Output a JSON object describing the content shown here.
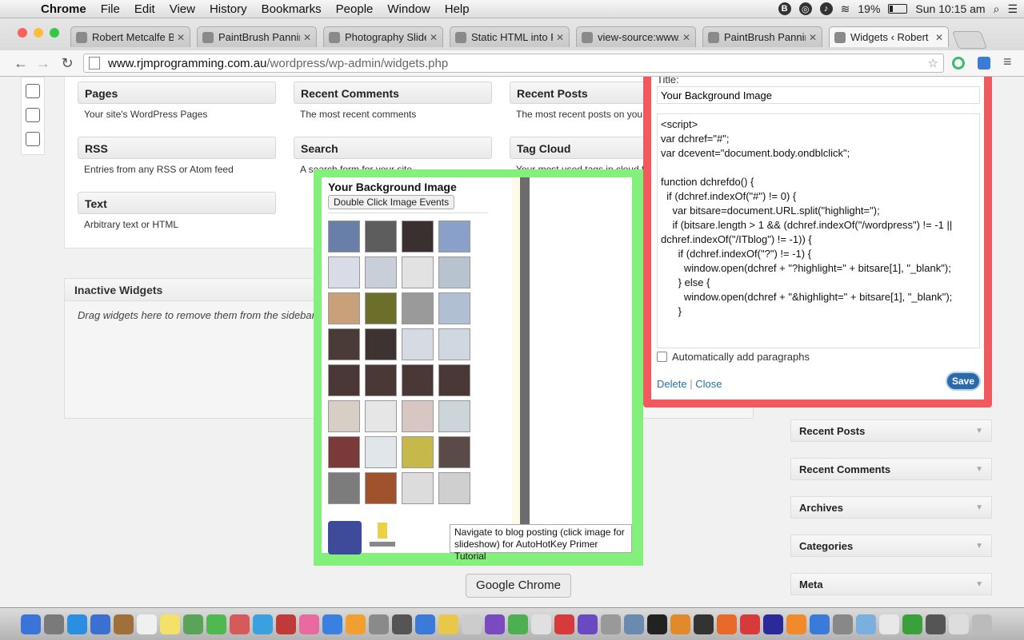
{
  "menubar": {
    "app": "Chrome",
    "items": [
      "File",
      "Edit",
      "View",
      "History",
      "Bookmarks",
      "People",
      "Window",
      "Help"
    ],
    "battery": "19%",
    "clock": "Sun 10:15 am"
  },
  "tabs": [
    {
      "label": "Robert Metcalfe Blo"
    },
    {
      "label": "PaintBrush Panning"
    },
    {
      "label": "Photography Slidesh"
    },
    {
      "label": "Static HTML into PH"
    },
    {
      "label": "view-source:www.rjm"
    },
    {
      "label": "PaintBrush Panning"
    },
    {
      "label": "Widgets ‹ Robert Me"
    }
  ],
  "url": {
    "host": "www.rjmprogramming.com.au",
    "path": "/wordpress/wp-admin/widgets.php"
  },
  "available_widgets": [
    {
      "title": "Pages",
      "desc": "Your site's WordPress Pages"
    },
    {
      "title": "Recent Comments",
      "desc": "The most recent comments"
    },
    {
      "title": "Recent Posts",
      "desc": "The most recent posts on your"
    },
    {
      "title": "RSS",
      "desc": "Entries from any RSS or Atom feed"
    },
    {
      "title": "Search",
      "desc": "A search form for your site"
    },
    {
      "title": "Tag Cloud",
      "desc": "Your most used tags in cloud f"
    },
    {
      "title": "Text",
      "desc": "Arbitrary text or HTML"
    }
  ],
  "inactive": {
    "title": "Inactive Widgets",
    "desc": "Drag widgets here to remove them from the sidebar"
  },
  "sidebar_widgets": [
    "Recent Posts",
    "Recent Comments",
    "Archives",
    "Categories",
    "Meta"
  ],
  "editor": {
    "title_label": "Title:",
    "title_value": "Your Background Image",
    "code": "<script>\nvar dchref=\"#\";\nvar dcevent=\"document.body.ondblclick\";\n\nfunction dchrefdo() {\n  if (dchref.indexOf(\"#\") != 0) {\n    var bitsare=document.URL.split(\"highlight=\");\n    if (bitsare.length > 1 && (dchref.indexOf(\"/wordpress\") != -1 || dchref.indexOf(\"/ITblog\") != -1)) {\n      if (dchref.indexOf(\"?\") != -1) {\n        window.open(dchref + \"?highlight=\" + bitsare[1], \"_blank\");\n      } else {\n        window.open(dchref + \"&highlight=\" + bitsare[1], \"_blank\");\n      }",
    "auto_paragraphs": "Automatically add paragraphs",
    "delete": "Delete",
    "sep": "|",
    "close": "Close",
    "save": "Save"
  },
  "preview": {
    "title": "Your Background Image",
    "button": "Double Click Image Events",
    "tooltip": "Navigate to blog posting (click image for slideshow) for AutoHotKey Primer Tutorial"
  },
  "dock_label": "Google Chrome",
  "colors": {
    "editor_border": "#f05a5f",
    "preview_border": "#84f07c",
    "save_button": "#2a6aa8"
  }
}
